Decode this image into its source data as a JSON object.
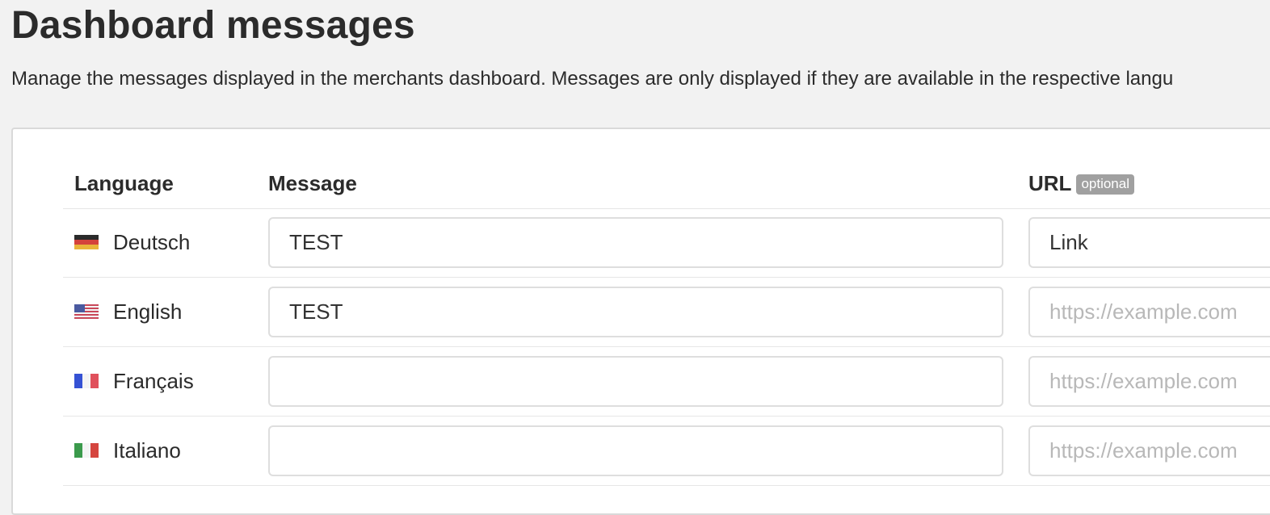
{
  "page": {
    "title": "Dashboard messages",
    "description": "Manage the messages displayed in the merchants dashboard. Messages are only displayed if they are available in the respective langu"
  },
  "table": {
    "headers": {
      "language": "Language",
      "message": "Message",
      "url": "URL",
      "url_badge": "optional"
    },
    "rows": [
      {
        "flag_icon": "germany-flag-icon",
        "language": "Deutsch",
        "message": "TEST",
        "url": "Link",
        "url_placeholder": ""
      },
      {
        "flag_icon": "usa-flag-icon",
        "language": "English",
        "message": "TEST",
        "url": "",
        "url_placeholder": "https://example.com"
      },
      {
        "flag_icon": "france-flag-icon",
        "language": "Français",
        "message": "",
        "url": "",
        "url_placeholder": "https://example.com"
      },
      {
        "flag_icon": "italy-flag-icon",
        "language": "Italiano",
        "message": "",
        "url": "",
        "url_placeholder": "https://example.com"
      }
    ]
  }
}
